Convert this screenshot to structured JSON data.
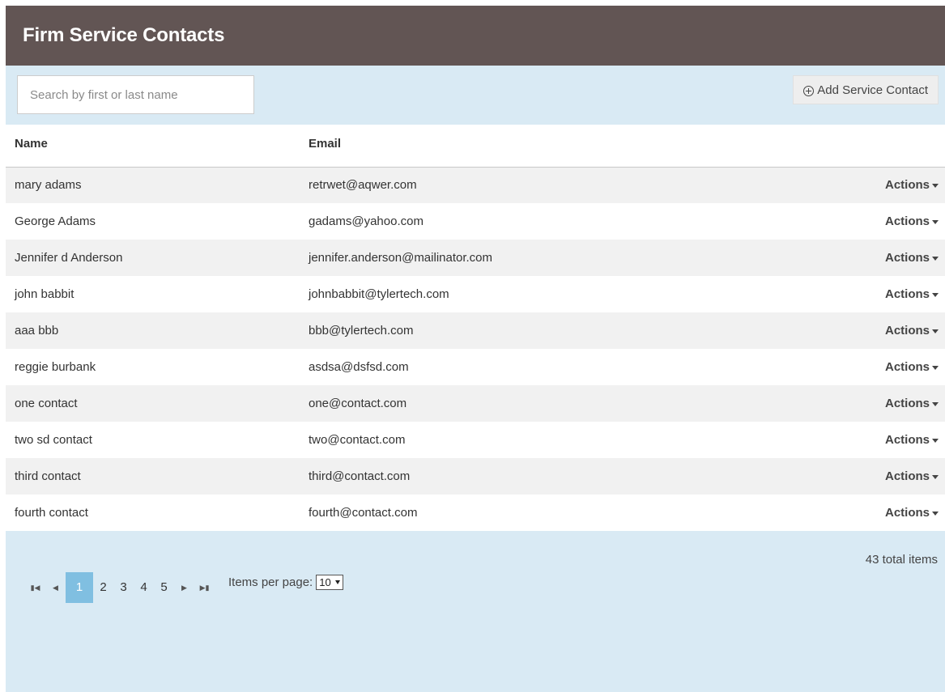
{
  "header": {
    "title": "Firm Service Contacts"
  },
  "toolbar": {
    "search_placeholder": "Search by first or last name",
    "add_button_label": "Add Service Contact",
    "add_button_icon": "plus-circle-icon"
  },
  "table": {
    "columns": [
      "Name",
      "Email",
      ""
    ],
    "actions_label": "Actions",
    "rows": [
      {
        "name": "mary adams",
        "email": "retrwet@aqwer.com"
      },
      {
        "name": "George Adams",
        "email": "gadams@yahoo.com"
      },
      {
        "name": "Jennifer d Anderson",
        "email": "jennifer.anderson@mailinator.com"
      },
      {
        "name": "john babbit",
        "email": "johnbabbit@tylertech.com"
      },
      {
        "name": "aaa bbb",
        "email": "bbb@tylertech.com"
      },
      {
        "name": "reggie burbank",
        "email": "asdsa@dsfsd.com"
      },
      {
        "name": "one contact",
        "email": "one@contact.com"
      },
      {
        "name": "two sd contact",
        "email": "two@contact.com"
      },
      {
        "name": "third contact",
        "email": "third@contact.com"
      },
      {
        "name": "fourth contact",
        "email": "fourth@contact.com"
      }
    ]
  },
  "pager": {
    "total_text": "43 total items",
    "first_icon": "⏮",
    "prev_icon": "◀",
    "next_icon": "▶",
    "last_icon": "⏭",
    "pages": [
      "1",
      "2",
      "3",
      "4",
      "5"
    ],
    "current_page": "1",
    "items_per_page_label": "Items per page:",
    "items_per_page_value": "10"
  },
  "colors": {
    "header_bg": "#625554",
    "panel_bg": "#d9eaf4",
    "active_page": "#80bfe1"
  }
}
